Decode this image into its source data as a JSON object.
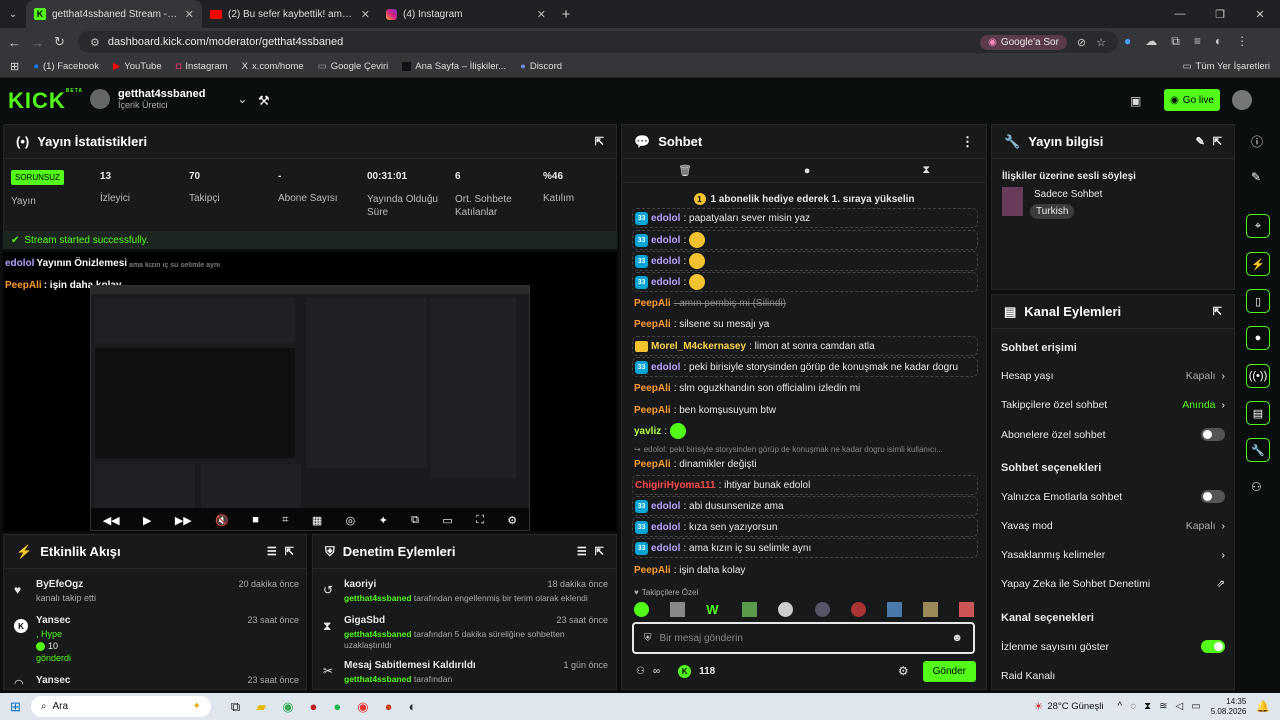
{
  "browser": {
    "tabs": [
      {
        "title": "getthat4ssbaned Stream - Kick"
      },
      {
        "title": "(2) Bu sefer kaybettik! ama üzü..."
      },
      {
        "title": "(4) Instagram"
      }
    ],
    "url": "dashboard.kick.com/moderator/getthat4ssbaned",
    "google_btn": "Google'a Sor",
    "bookmarks": [
      "(1) Facebook",
      "YouTube",
      "Instagram",
      "x.com/home",
      "Google Çeviri",
      "Ana Sayfa – İlişkiler...",
      "Discord"
    ],
    "all_bookmarks": "Tüm Yer İşaretleri"
  },
  "header": {
    "logo": "KICK",
    "logo_beta": "BETA",
    "channel_name": "getthat4ssbaned",
    "channel_role": "İçerik Üretici",
    "go_live": "Go live"
  },
  "stats": {
    "title": "Yayın İstatistikleri",
    "badge": "SORUNSUZ",
    "badge_label": "Yayın",
    "items": [
      {
        "value": "13",
        "label": "İzleyici"
      },
      {
        "value": "70",
        "label": "Takipçi"
      },
      {
        "value": "-",
        "label": "Abone Sayısı"
      },
      {
        "value": "00:31:01",
        "label": "Yayında Olduğu Süre"
      },
      {
        "value": "6",
        "label": "Ort. Sohbete Katılanlar"
      },
      {
        "value": "%46",
        "label": "Katılım"
      }
    ],
    "status": "Stream started successfully."
  },
  "preview": {
    "overlay1_user": "edolol",
    "overlay1_text": "Yayının Önizlemesi",
    "overlay1_extra": "ama kızın iç su selimle aynı",
    "overlay2_user": "PeepAli",
    "overlay2_text": ": işin daha kolay"
  },
  "activity": {
    "title": "Etkinlik Akışı",
    "items": [
      {
        "name": "ByEfeOgz",
        "desc": "kanalı takip etti",
        "time": "20 dakika önce"
      },
      {
        "name": "Yansec",
        "desc": ", Hype",
        "amount": "10",
        "sub": "gönderdi",
        "time": "23 saat önce"
      },
      {
        "name": "Yansec",
        "time": "23 saat önce"
      }
    ]
  },
  "moderation": {
    "title": "Denetim Eylemleri",
    "items": [
      {
        "name": "kaoriyi",
        "actor": "getthat4ssbaned",
        "desc": "tarafından engellenmiş bir terim olarak eklendi",
        "time": "18 dakika önce"
      },
      {
        "name": "GigaSbd",
        "actor": "getthat4ssbaned",
        "desc": "tarafından 5 dakika süreliğine sohbetten uzaklaştırıldı",
        "time": "23 saat önce"
      },
      {
        "name": "Mesaj Sabitlemesi Kaldırıldı",
        "actor": "getthat4ssbaned",
        "desc": "tarafından",
        "time": "1 gün önce"
      }
    ]
  },
  "chat": {
    "title": "Sohbet",
    "pinned": "1 abonelik hediye ederek 1. sıraya yükselin",
    "messages": [
      {
        "user": "edolol",
        "text": ": papatyaları sever misin yaz"
      },
      {
        "user": "edolol",
        "text": ":"
      },
      {
        "user": "edolol",
        "text": ":"
      },
      {
        "user": "edolol",
        "text": ":"
      },
      {
        "user": "PeepAli",
        "text": ": amın pembiş mi (Silindi)"
      },
      {
        "user": "PeepAli",
        "text": ": silsene su mesajı ya"
      },
      {
        "user": "Morel_M4ckernasey",
        "text": ": limon at sonra camdan atla"
      },
      {
        "user": "edolol",
        "text": ": peki birisiyle storysinden görüp de konuşmak ne kadar dogru"
      },
      {
        "user": "PeepAli",
        "text": ": slm oguzkhandın son officialını izledin mi"
      },
      {
        "user": "PeepAli",
        "text": ": ben komşusuyum btw"
      },
      {
        "user": "yavliz",
        "text": ":"
      },
      {
        "reply": "edolol: peki birisiyle storysinden görüp de konuşmak ne kadar dogru isimli kullanıcı...",
        "user": "PeepAli",
        "text": ": dinamikler değişti"
      },
      {
        "user": "ChigiriHyoma111",
        "text": ": ihtiyar bunak edolol"
      },
      {
        "user": "edolol",
        "text": ": abi dusunsenize ama"
      },
      {
        "user": "edolol",
        "text": ": kıza sen yazıyorsun"
      },
      {
        "user": "edolol",
        "text": ": ama kızın iç su selimle aynı"
      },
      {
        "user": "PeepAli",
        "text": ": işin daha kolay"
      }
    ],
    "emote_section": "Takipçilere Özel",
    "input_placeholder": "Bir mesaj gönderin",
    "points": "118",
    "send": "Gönder"
  },
  "stream_info": {
    "title": "Yayın bilgisi",
    "stream_title": "İlişkiler üzerine sesli söyleşi",
    "category": "Sadece Sohbet",
    "tag": "Turkish"
  },
  "channel_actions": {
    "title": "Kanal Eylemleri",
    "chat_access": "Sohbet erişimi",
    "rows1": [
      {
        "label": "Hesap yaşı",
        "value": "Kapalı"
      },
      {
        "label": "Takipçilere özel sohbet",
        "value": "Anında"
      },
      {
        "label": "Abonelere özel sohbet",
        "value": ""
      }
    ],
    "chat_options": "Sohbet seçenekleri",
    "rows2": [
      {
        "label": "Yalnızca Emotlarla sohbet",
        "value": ""
      },
      {
        "label": "Yavaş mod",
        "value": "Kapalı"
      },
      {
        "label": "Yasaklanmış kelimeler",
        "value": ""
      },
      {
        "label": "Yapay Zeka ile Sohbet Denetimi",
        "value": ""
      }
    ],
    "channel_options": "Kanal seçenekleri",
    "rows3": [
      {
        "label": "İzlenme sayısını göster",
        "value": ""
      },
      {
        "label": "Raid Kanalı",
        "value": ""
      }
    ]
  },
  "taskbar": {
    "search": "Ara",
    "weather": "28°C Güneşli",
    "time": "14:35",
    "date": "5.08.2026"
  }
}
